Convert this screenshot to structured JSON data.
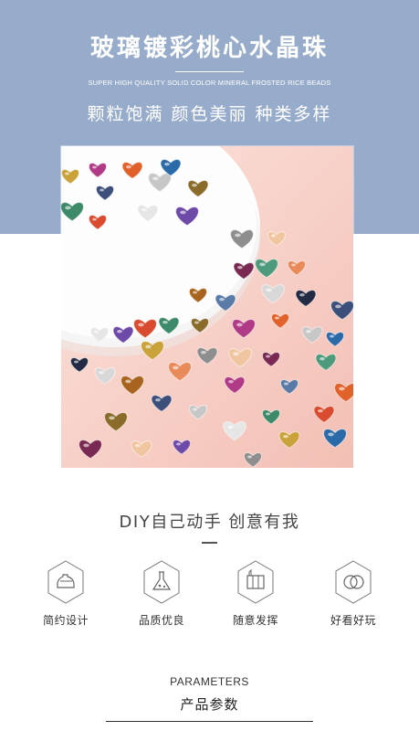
{
  "header": {
    "title": "玻璃镀彩桃心水晶珠",
    "subtitle_en": "SUPER HIGH QUALITY SOLID COLOR MINERAL FROSTED RICE BEADS",
    "tagline": "颗粒饱满 颜色美丽 种类多样",
    "band_color": "#97accb"
  },
  "photo": {
    "icon": "heart-beads-photo",
    "background_color": "#f7cfc6"
  },
  "diy": {
    "heading": "DIY自己动手 创意有我"
  },
  "features": [
    {
      "label": "简约设计",
      "icon": "iron-icon"
    },
    {
      "label": "品质优良",
      "icon": "flask-icon"
    },
    {
      "label": "随意发挥",
      "icon": "palette-icon"
    },
    {
      "label": "好看好玩",
      "icon": "rings-icon"
    }
  ],
  "parameters": {
    "heading_en": "PARAMETERS",
    "heading_cn": "产品参数"
  }
}
